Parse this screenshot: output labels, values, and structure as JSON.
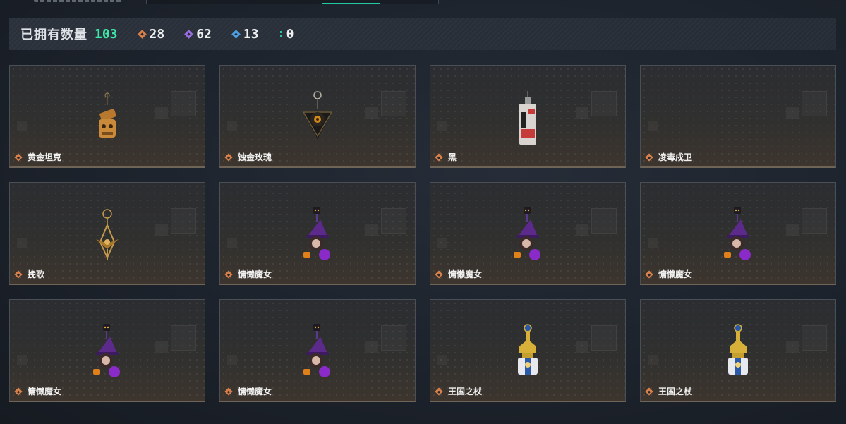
{
  "stats": {
    "owned_label": "已拥有数量",
    "owned_total": "103",
    "counters": [
      {
        "icon": "orange-diamond-icon",
        "color": "#d9804a",
        "value": "28"
      },
      {
        "icon": "purple-diamond-icon",
        "color": "#9a6ee0",
        "value": "62"
      },
      {
        "icon": "blue-diamond-icon",
        "color": "#4f9fe0",
        "value": "13"
      },
      {
        "icon": "teal-dots-icon",
        "color": "#29c7a0",
        "value": "0"
      }
    ]
  },
  "items": [
    {
      "name": "黄金坦克",
      "art": "golden-tank-charm"
    },
    {
      "name": "蚀金玫瑰",
      "art": "black-rose-charm"
    },
    {
      "name": "黑",
      "art": "red-card-charm"
    },
    {
      "name": "凌毒戍卫",
      "art": "none"
    },
    {
      "name": "挽歌",
      "art": "gold-compass-charm"
    },
    {
      "name": "慵懒魔女",
      "art": "witch-charm"
    },
    {
      "name": "慵懒魔女",
      "art": "witch-charm"
    },
    {
      "name": "慵懒魔女",
      "art": "witch-charm"
    },
    {
      "name": "慵懒魔女",
      "art": "witch-charm"
    },
    {
      "name": "慵懒魔女",
      "art": "witch-charm"
    },
    {
      "name": "王国之杖",
      "art": "kingdom-scepter-charm"
    },
    {
      "name": "王国之杖",
      "art": "kingdom-scepter-charm"
    }
  ],
  "colors": {
    "accent": "#3ee7a7",
    "rarity": "#d9804a"
  }
}
